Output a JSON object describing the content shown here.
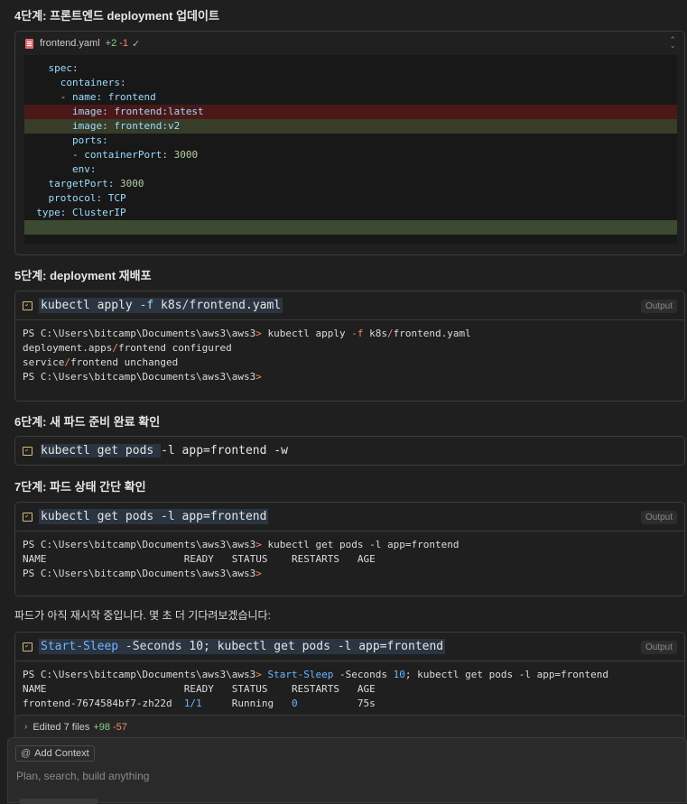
{
  "step4": {
    "heading": "4단계: 프론트엔드 deployment 업데이트",
    "file_name": "frontend.yaml",
    "additions": "+2",
    "deletions": "-1",
    "lines": {
      "l1_key": "spec:",
      "l2_key": "containers:",
      "l3_dash": "- ",
      "l3_key": "name: ",
      "l3_val": "frontend",
      "l4_key": "image: ",
      "l4_val": "frontend:latest",
      "l5_key": "image: ",
      "l5_val": "frontend:v2",
      "l6_key": "ports:",
      "l7_dash": "- ",
      "l7_key": "containerPort: ",
      "l7_val": "3000",
      "l8_key": "env:",
      "l9_key": "targetPort: ",
      "l9_val": "3000",
      "l10_key": "protocol: ",
      "l10_val": "TCP",
      "l11_key": "type: ",
      "l11_val": "ClusterIP"
    }
  },
  "step5": {
    "heading": "5단계: deployment 재배포",
    "cmd_a": "kubectl apply ",
    "cmd_flag": "-f",
    "cmd_b": " k8s",
    "cmd_slash": "/",
    "cmd_c": "frontend.yaml",
    "output_label": "Output",
    "out1_prompt": "PS C:\\Users\\bitcamp\\Documents\\aws3\\aws3",
    "out1_gt": ">",
    "out1_cmd_a": " kubectl apply ",
    "out1_flag": "-f",
    "out1_cmd_b": " k8s",
    "out1_slash": "/",
    "out1_cmd_c": "frontend.yaml",
    "out2_a": "deployment.apps",
    "out2_slash": "/",
    "out2_b": "frontend configured",
    "out3_a": "service",
    "out3_slash": "/",
    "out3_b": "frontend unchanged",
    "out4_prompt": "PS C:\\Users\\bitcamp\\Documents\\aws3\\aws3",
    "out4_gt": ">"
  },
  "step6": {
    "heading": "6단계: 새 파드 준비 완료 확인",
    "cmd_a": "kubectl get pods ",
    "cmd_rest": "-l app=frontend -w"
  },
  "step7": {
    "heading": "7단계: 파드 상태 간단 확인",
    "cmd": "kubectl get pods -l app=frontend",
    "output_label": "Output",
    "out1_prompt": "PS C:\\Users\\bitcamp\\Documents\\aws3\\aws3",
    "out1_gt": ">",
    "out1_cmd": " kubectl get pods -l app=frontend",
    "out2": "NAME                       READY   STATUS    RESTARTS   AGE",
    "out3_prompt": "PS C:\\Users\\bitcamp\\Documents\\aws3\\aws3",
    "out3_gt": ">"
  },
  "note": "파드가 아직 재시작 중입니다. 몇 초 더 기다려보겠습니다:",
  "step8": {
    "cmd_a": "Start-Sleep ",
    "cmd_flag": "-Seconds",
    "cmd_b": " 10; kubectl get pods ",
    "cmd_flag2": "-l",
    "cmd_c": " app=frontend",
    "output_label": "Output",
    "out1_prompt": "PS C:\\Users\\bitcamp\\Documents\\aws3\\aws3",
    "out1_gt": ">",
    "out1_cmd_a": " Start-Sleep",
    "out1_cmd_b": " -Seconds ",
    "out1_num": "10",
    "out1_cmd_c": "; kubectl get pods -l app=frontend",
    "out2": "NAME                       READY   STATUS    RESTARTS   AGE",
    "out3_name": "frontend-7674584bf7-zh22d  ",
    "out3_ready": "1/1",
    "out3_status": "     Running   ",
    "out3_restarts": "0",
    "out3_age": "          75s"
  },
  "edited": {
    "label": "Edited 7 files",
    "additions": "+98",
    "deletions": "-57"
  },
  "chat": {
    "add_context": "Add Context",
    "placeholder": "Plan, search, build anything"
  }
}
